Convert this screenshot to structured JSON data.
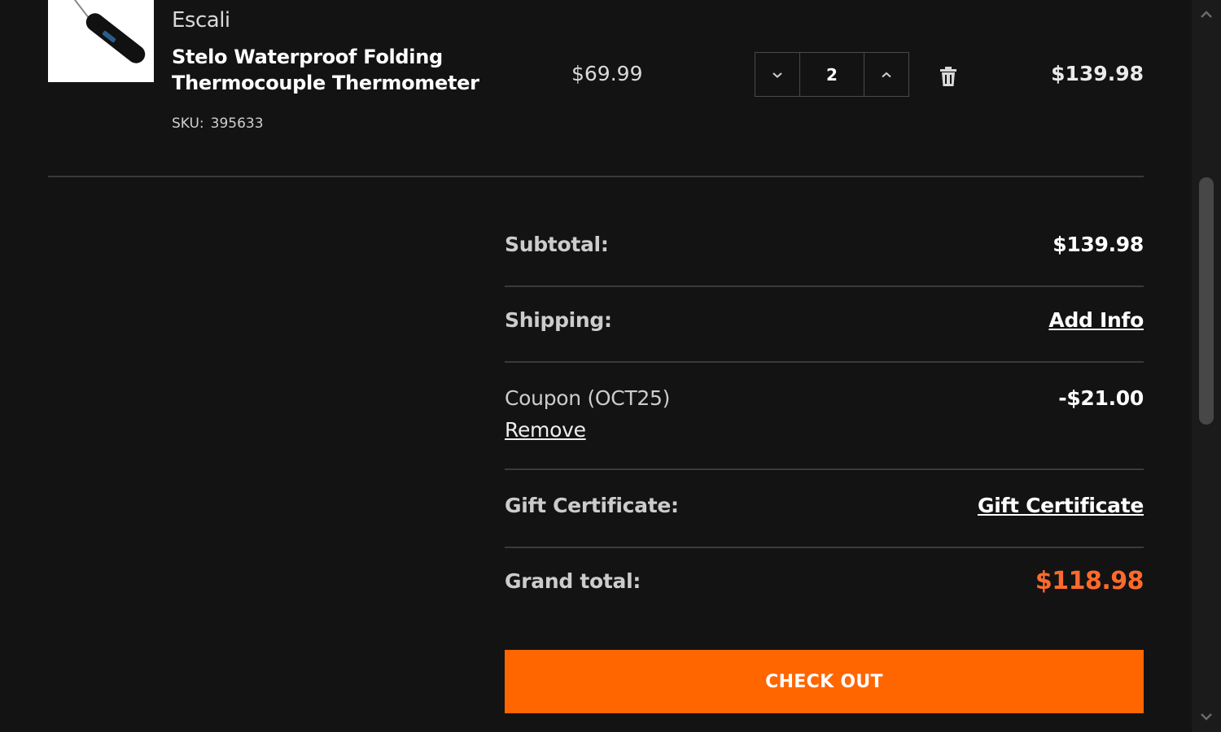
{
  "product": {
    "brand": "Escali",
    "name": "Stelo Waterproof Folding Thermocouple Thermometer",
    "sku_label": "SKU:",
    "sku": "395633",
    "unit_price": "$69.99",
    "quantity": "2",
    "line_total": "$139.98",
    "image_icon": "thermometer-product-image"
  },
  "summary": {
    "subtotal_label": "Subtotal:",
    "subtotal_value": "$139.98",
    "shipping_label": "Shipping:",
    "shipping_link": "Add Info",
    "coupon_label": "Coupon (OCT25)",
    "coupon_remove": "Remove",
    "coupon_value": "-$21.00",
    "gift_label": "Gift Certificate:",
    "gift_link": "Gift Certificate",
    "grand_label": "Grand total:",
    "grand_value": "$118.98"
  },
  "checkout_label": "CHECK OUT",
  "colors": {
    "background": "#131313",
    "accent": "#ff6600",
    "grand_total": "#ff6a2c"
  },
  "icons": {
    "decrease": "chevron-down-icon",
    "increase": "chevron-up-icon",
    "delete": "trash-icon",
    "scroll_up": "scroll-up-arrow-icon",
    "scroll_down": "scroll-down-arrow-icon"
  }
}
